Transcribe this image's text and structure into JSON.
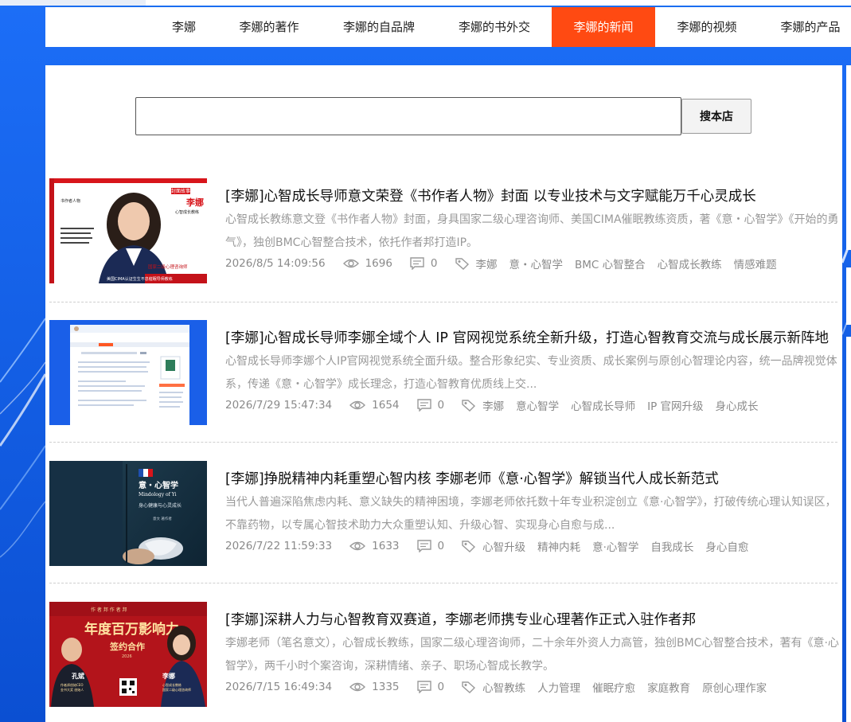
{
  "nav": {
    "items": [
      "李娜",
      "李娜的著作",
      "李娜的自品牌",
      "李娜的书外交",
      "李娜的新闻",
      "李娜的视频",
      "李娜的产品"
    ],
    "active_index": 4
  },
  "search": {
    "value": "",
    "placeholder": "",
    "button_label": "搜本店"
  },
  "colors": {
    "background": "#0f5fe6",
    "nav_active": "#ff4a12",
    "meta_text": "#8a8a8a"
  },
  "icons": {
    "views": "eye-icon",
    "comments": "comment-icon",
    "tags": "tag-icon"
  },
  "articles": [
    {
      "title": "[李娜]心智成长导师意文荣登《书作者人物》封面 以专业技术与文字赋能万千心灵成长",
      "summary": "心智成长教练意文登《书作者人物》封面，身具国家二级心理咨询师、美国CIMA催眠教练资质，著《意・心智学》《开始的勇气》，独创BMC心智整合技术，依托作者邦打造IP。",
      "date": "2026/8/5 14:09:56",
      "views": "1696",
      "comments": "0",
      "tags": [
        "李娜",
        "意・心智学",
        "BMC 心智整合",
        "心智成长教练",
        "情感难题"
      ],
      "thumb": {
        "side_text": "书作者人物",
        "badge": "封面故事",
        "name": "李娜",
        "subtitle": "心智成长教练",
        "footer1": "国家二级心理咨询师",
        "footer2": "美国CIMA认证生生不息催眠导师教练"
      }
    },
    {
      "title": "[李娜]心智成长导师李娜全域个人 IP 官网视觉系统全新升级，打造心智教育交流与成长展示新阵地",
      "summary": "心智成长导师李娜个人IP官网视觉系统全面升级。整合形象纪实、专业资质、成长案例与原创心智理论内容，统一品牌视觉体系，传递《意・心智学》成长理念，打造心智教育优质线上交...",
      "date": "2026/7/29 15:47:34",
      "views": "1654",
      "comments": "0",
      "tags": [
        "李娜",
        "意心智学",
        "心智成长导师",
        "IP 官网升级",
        "身心成长"
      ]
    },
    {
      "title": "[李娜]挣脱精神内耗重塑心智内核 李娜老师《意·心智学》解锁当代人成长新范式",
      "summary": "当代人普遍深陷焦虑内耗、意义缺失的精神困境，李娜老师依托数十年专业积淀创立《意·心智学》，打破传统心理认知误区，不靠药物，以专属心智技术助力大众重塑认知、升级心智、实现身心自愈与成...",
      "date": "2026/7/22 11:59:33",
      "views": "1633",
      "comments": "0",
      "tags": [
        "心智升级",
        "精神内耗",
        "意·心智学",
        "自我成长",
        "身心自愈"
      ],
      "thumb": {
        "book_title": "意・心智学",
        "book_en": "Mindology of Yi",
        "book_sub": "身心健康与心灵成长",
        "author": "意文  著作者"
      }
    },
    {
      "title": "[李娜]深耕人力与心智教育双赛道，李娜老师携专业心理著作正式入驻作者邦",
      "summary": "李娜老师（笔名意文），心智成长教练，国家二级心理咨询师，二十余年外资人力高管，独创BMC心智整合技术，著有《意·心智学》，两千小时个案咨询，深耕情绪、亲子、职场心智成长教学。",
      "date": "2026/7/15 16:49:34",
      "views": "1335",
      "comments": "0",
      "tags": [
        "心智教练",
        "人力管理",
        "催眠疗愈",
        "家庭教育",
        "原创心理作家"
      ],
      "thumb": {
        "top_text": "作 者 邦 作 者 邦",
        "headline": "年度百万影响力",
        "sign": "签约合作",
        "year": "2026",
        "left_name": "孔斌",
        "left_role1": "作者邦创始CEO",
        "left_role2": "金书大奖 创始人",
        "right_name": "李娜",
        "right_role1": "心智成长教练",
        "right_role2": "国家二级心理咨询师"
      }
    }
  ]
}
